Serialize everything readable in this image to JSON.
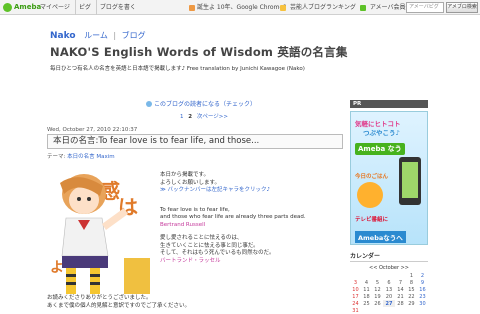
{
  "topbar": {
    "logo": "Ameba",
    "nav": [
      "マイページ",
      "ピグ",
      "ブログを書く"
    ],
    "mid_text": "誕生よ 10年、Google Chrome?",
    "right": [
      "芸能人ブログランキング",
      "アメーバ会員登録"
    ],
    "search_placeholder": "アメーバピグ",
    "search_button": "アメブロ検索"
  },
  "header": {
    "author": "Nako",
    "links": [
      "ルーム",
      "ブログ"
    ],
    "title": "NAKO'S English Words of Wisdom 英語の名言集",
    "description": "毎日ひとつ有名人の名言を英語と日本語で掲載します♪ Free translation by Junichi Kawagoe (Nako)"
  },
  "reader_link": "このブログの読者になる（チェック）",
  "pager": {
    "prev": "1",
    "current": "2",
    "next_label": "次ページ>>"
  },
  "post": {
    "date": "Wed, October 27, 2010 22:10:37",
    "title": "本日の名言:To fear love is to fear life, and those...",
    "theme_label": "テーマ:",
    "theme_value": "本日の名言 Maxim",
    "intro1": "本日から掲載です。",
    "intro2": "よろしくお願いします。",
    "backnumber": "≫ バックナンバーは左記キャラをクリック♪",
    "quote1": "To fear love is to fear life,",
    "quote2": "and those who fear life are already three parts dead.",
    "author_en": "Bertrand Russell",
    "ja1": "愛し愛されることに怯えるのは、",
    "ja2": "生きていくことに怯える事と同じ事だ。",
    "ja3": "そして、それはもう死んでいるも同然なのだ。",
    "author_ja": "バートランド・ラッセル",
    "footer1": "お読みくださりありがとうございました。",
    "footer2": "あくまで僕の個人的見解と意訳ですのでご了承ください。"
  },
  "sidebar": {
    "pr": "PR",
    "banner": {
      "line1": "気軽にヒトコト",
      "line2": "つぶやこう♪",
      "brand": "Ameba なう",
      "l4": "今日のごはん",
      "l5": "テレビ番組に",
      "cta": "Amebaなうへ"
    },
    "calendar": {
      "title": "カレンダー",
      "nav": "<< October >>",
      "rows": [
        [
          "",
          "",
          "",
          "",
          "",
          "1",
          "2"
        ],
        [
          "3",
          "4",
          "5",
          "6",
          "7",
          "8",
          "9"
        ],
        [
          "10",
          "11",
          "12",
          "13",
          "14",
          "15",
          "16"
        ],
        [
          "17",
          "18",
          "19",
          "20",
          "21",
          "22",
          "23"
        ],
        [
          "24",
          "25",
          "26",
          "27",
          "28",
          "29",
          "30"
        ],
        [
          "31",
          "",
          "",
          "",
          "",
          "",
          ""
        ]
      ]
    }
  },
  "colors": {
    "accent": "#3366cc",
    "ameba_green": "#5ec228",
    "pink": "#c4379a"
  }
}
